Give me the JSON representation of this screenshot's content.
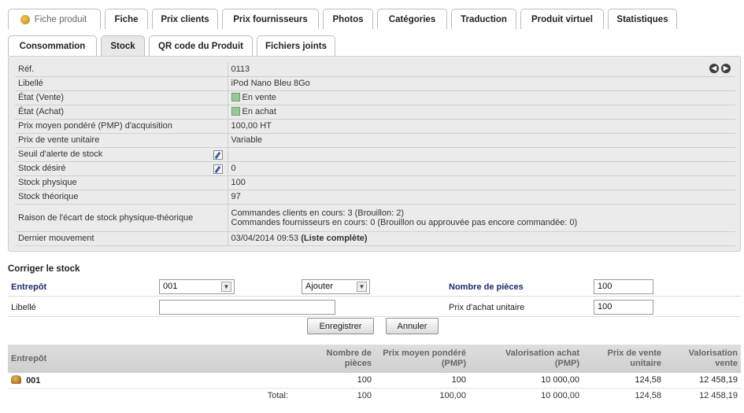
{
  "tabs_row1": [
    {
      "label": "Fiche produit",
      "name": "tab-fiche-produit"
    },
    {
      "label": "Fiche",
      "name": "tab-fiche"
    },
    {
      "label": "Prix clients",
      "name": "tab-prix-clients"
    },
    {
      "label": "Prix fournisseurs",
      "name": "tab-prix-fournisseurs"
    },
    {
      "label": "Photos",
      "name": "tab-photos"
    },
    {
      "label": "Catégories",
      "name": "tab-categories"
    },
    {
      "label": "Traduction",
      "name": "tab-traduction"
    },
    {
      "label": "Produit virtuel",
      "name": "tab-produit-virtuel"
    },
    {
      "label": "Statistiques",
      "name": "tab-statistiques"
    }
  ],
  "tabs_row2": [
    {
      "label": "Consommation",
      "name": "tab-consommation"
    },
    {
      "label": "Stock",
      "name": "tab-stock",
      "active": true
    },
    {
      "label": "QR code du Produit",
      "name": "tab-qr-code"
    },
    {
      "label": "Fichiers joints",
      "name": "tab-fichiers-joints"
    }
  ],
  "info": {
    "ref_label": "Réf.",
    "ref_value": "0113",
    "libelle_label": "Libellé",
    "libelle_value": "iPod Nano Bleu 8Go",
    "etat_vente_label": "État (Vente)",
    "etat_vente_value": "En vente",
    "etat_achat_label": "État (Achat)",
    "etat_achat_value": "En achat",
    "pmp_label": "Prix moyen pondéré (PMP) d'acquisition",
    "pmp_value": "100,00 HT",
    "pv_label": "Prix de vente unitaire",
    "pv_value": "Variable",
    "seuil_label": "Seuil d'alerte de stock",
    "seuil_value": "",
    "stock_desire_label": "Stock désiré",
    "stock_desire_value": "0",
    "stock_physique_label": "Stock physique",
    "stock_physique_value": "100",
    "stock_theorique_label": "Stock théorique",
    "stock_theorique_value": "97",
    "raison_label": "Raison de l'écart de stock physique-théorique",
    "raison_line1": "Commandes clients en cours: 3 (Brouillon: 2)",
    "raison_line2": "Commandes fournisseurs en cours: 0 (Brouillon ou approuvée pas encore commandée: 0)",
    "dernier_label": "Dernier mouvement",
    "dernier_value": "03/04/2014 09:53",
    "liste_complete": "(Liste complète)"
  },
  "form": {
    "title": "Corriger le stock",
    "entrepot_label": "Entrepôt",
    "entrepot_value": "001",
    "action_value": "Ajouter",
    "nombre_label": "Nombre de pièces",
    "nombre_value": "100",
    "libelle_label": "Libellé",
    "libelle_value": "",
    "prix_label": "Prix d'achat unitaire",
    "prix_value": "100",
    "save_label": "Enregistrer",
    "cancel_label": "Annuler"
  },
  "stock_table": {
    "headers": {
      "entrepot": "Entrepôt",
      "nombre": [
        "Nombre de",
        "pièces"
      ],
      "pmp": [
        "Prix moyen pondéré",
        "(PMP)"
      ],
      "val_achat": [
        "Valorisation achat",
        "(PMP)"
      ],
      "pv": [
        "Prix de vente",
        "unitaire"
      ],
      "val_vente": [
        "Valorisation",
        "vente"
      ]
    },
    "row": {
      "entrepot": "001",
      "nombre": "100",
      "pmp": "100",
      "val_achat": "10 000,00",
      "pv": "124,58",
      "val_vente": "12 458,19"
    },
    "total": {
      "label": "Total:",
      "nombre": "100",
      "pmp": "100,00",
      "val_achat": "10 000,00",
      "pv": "124,58",
      "val_vente": "12 458,19"
    }
  }
}
